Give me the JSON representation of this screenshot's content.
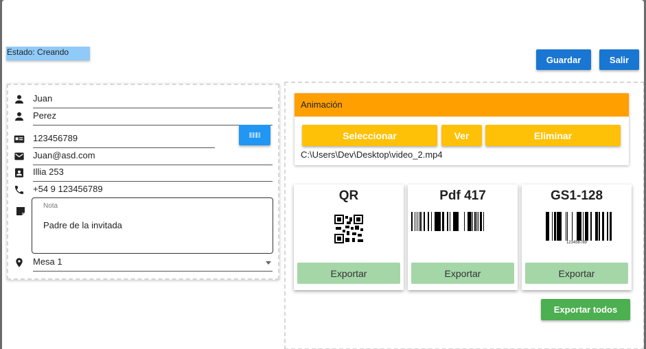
{
  "status": "Estado: Creando",
  "header": {
    "save_label": "Guardar",
    "exit_label": "Salir"
  },
  "form": {
    "first_name": "Juan",
    "last_name": "Perez",
    "document": "123456789",
    "email": "Juan@asd.com",
    "address": "Illia 253",
    "phone": "+54 9 123456789",
    "note_label": "Nota",
    "note_value": "Padre de la invitada",
    "table_selected": "Mesa 1"
  },
  "animation": {
    "title": "Animación",
    "select_label": "Seleccionar",
    "view_label": "Ver",
    "delete_label": "Eliminar",
    "file_path": "C:\\Users\\Dev\\Desktop\\video_2.mp4"
  },
  "codes": [
    {
      "title": "QR",
      "export_label": "Exportar"
    },
    {
      "title": "Pdf 417",
      "export_label": "Exportar"
    },
    {
      "title": "GS1-128",
      "export_label": "Exportar",
      "caption": "123456789"
    }
  ],
  "export_all_label": "Exportar todos",
  "colors": {
    "primary": "#1976d2",
    "status_bg": "#90caf9",
    "animation_header": "#ffa000",
    "animation_buttons": "#ffc107",
    "export_button": "#a5d6a7",
    "export_all": "#4caf50"
  },
  "icons": [
    "person-icon",
    "id-card-icon",
    "email-icon",
    "contact-icon",
    "phone-icon",
    "note-icon",
    "location-icon",
    "barcode-icon",
    "chevron-down-icon"
  ]
}
